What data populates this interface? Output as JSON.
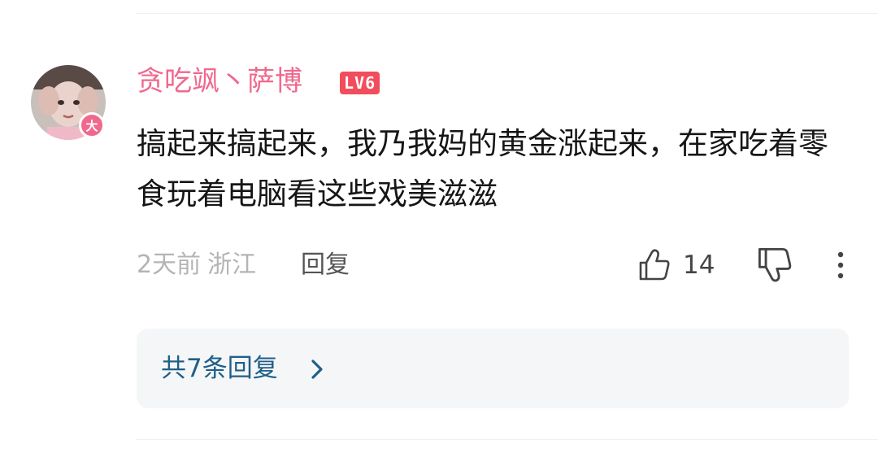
{
  "comment": {
    "username": "贪吃飒丶萨博",
    "level": "LV6",
    "vip_badge": "大",
    "avatar_icon": "user-avatar-icon",
    "text": "搞起来搞起来，我乃我妈的黄金涨起来，在家吃着零食玩着电脑看这些戏美滋滋",
    "time_ago": "2天前",
    "location": "浙江",
    "reply_label": "回复",
    "like_count": "14",
    "like_icon": "thumbs-up-icon",
    "dislike_icon": "thumbs-down-icon",
    "more_icon": "more-vertical-icon"
  },
  "replies": {
    "summary": "共7条回复",
    "chevron_icon": "chevron-right-icon"
  },
  "colors": {
    "username": "#f0688e",
    "level_badge": "#f24d5c",
    "vip_badge": "#f0688e",
    "replies_link": "#1f5f88",
    "meta_text": "#b4b4b4"
  }
}
